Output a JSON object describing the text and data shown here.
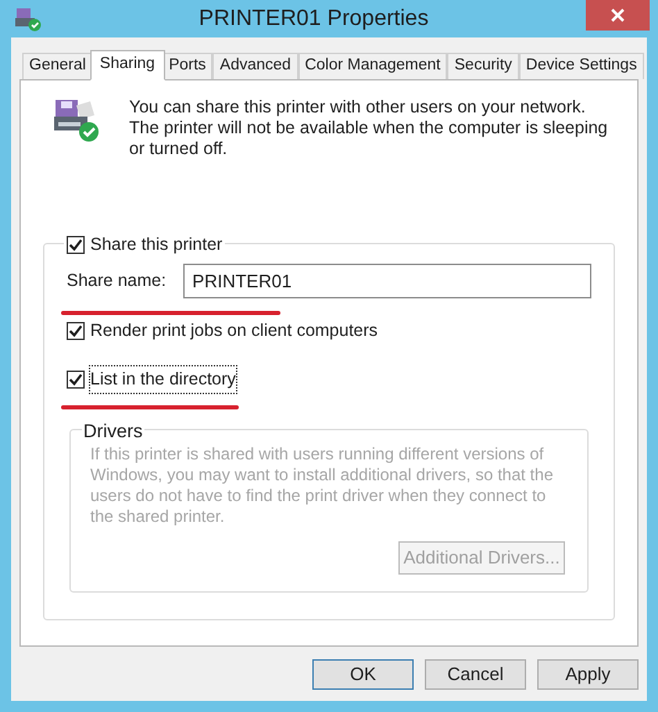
{
  "window": {
    "title": "PRINTER01 Properties"
  },
  "tabs": [
    {
      "label": "General",
      "selected": false
    },
    {
      "label": "Sharing",
      "selected": true
    },
    {
      "label": "Ports",
      "selected": false
    },
    {
      "label": "Advanced",
      "selected": false
    },
    {
      "label": "Color Management",
      "selected": false
    },
    {
      "label": "Security",
      "selected": false
    },
    {
      "label": "Device Settings",
      "selected": false
    }
  ],
  "description": "You can share this printer with other users on your network. The printer will not be available when the computer is sleeping or turned off.",
  "share_group": {
    "share_checkbox": {
      "label": "Share this printer",
      "checked": true
    },
    "share_name": {
      "label": "Share name:",
      "value": "PRINTER01",
      "annotated": true
    },
    "options": [
      {
        "label": "Render print jobs on client computers",
        "checked": true,
        "focused": false,
        "annotated": false
      },
      {
        "label": "List in the directory",
        "checked": true,
        "focused": true,
        "annotated": true
      }
    ],
    "drivers": {
      "title": "Drivers",
      "text": "If this printer is shared with users running different versions of Windows, you may want to install additional drivers, so that the users do not have to find the print driver when they connect to the shared printer.",
      "disabled": true,
      "button": {
        "label": "Additional Drivers...",
        "disabled": true
      }
    }
  },
  "buttons": [
    {
      "label": "OK",
      "default": true
    },
    {
      "label": "Cancel",
      "default": false
    },
    {
      "label": "Apply",
      "default": false
    }
  ]
}
